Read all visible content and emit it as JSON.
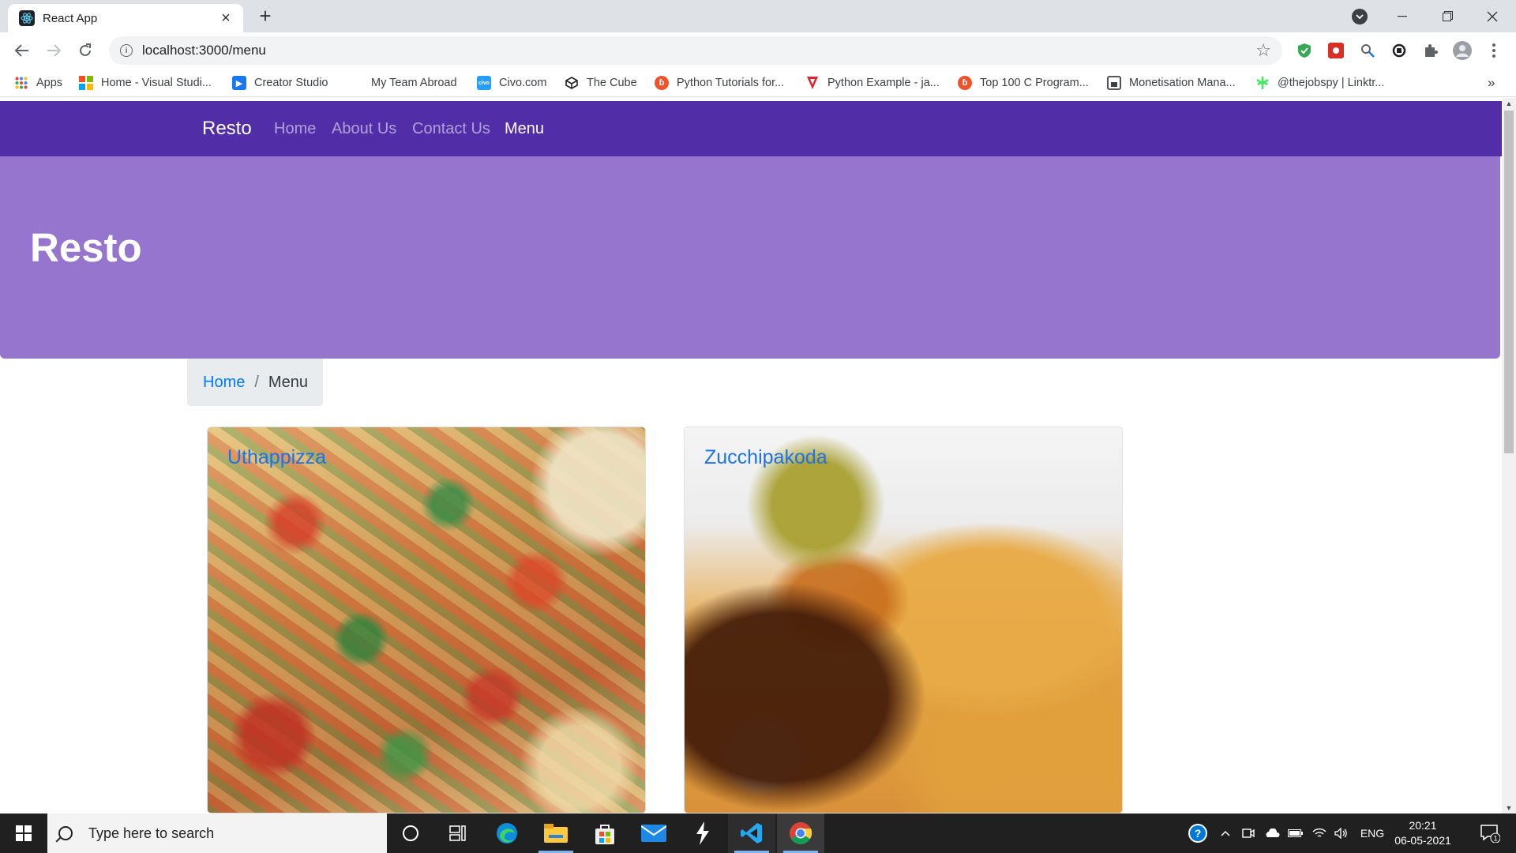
{
  "browser": {
    "tab_title": "React App",
    "url": "localhost:3000/menu",
    "bookmarks": [
      {
        "label": "Apps",
        "icon": "apps-grid-icon"
      },
      {
        "label": "Home - Visual Studi...",
        "icon": "microsoft-icon"
      },
      {
        "label": "Creator Studio",
        "icon": "creator-studio-icon"
      },
      {
        "label": "My Team Abroad",
        "icon": "none"
      },
      {
        "label": "Civo.com",
        "icon": "civo-icon"
      },
      {
        "label": "The Cube",
        "icon": "cube-icon"
      },
      {
        "label": "Python Tutorials for...",
        "icon": "orange-circle-icon"
      },
      {
        "label": "Python Example - ja...",
        "icon": "red-v-icon"
      },
      {
        "label": "Top 100 C Program...",
        "icon": "orange-circle-icon"
      },
      {
        "label": "Monetisation Mana...",
        "icon": "doc-icon"
      },
      {
        "label": "@thejobspy | Linktr...",
        "icon": "linktree-icon"
      }
    ],
    "overflow_glyph": "»"
  },
  "app": {
    "brand": "Resto",
    "nav": [
      {
        "label": "Home",
        "active": false
      },
      {
        "label": "About Us",
        "active": false
      },
      {
        "label": "Contact Us",
        "active": false
      },
      {
        "label": "Menu",
        "active": true
      }
    ],
    "jumbotron_title": "Resto",
    "breadcrumb": {
      "home": "Home",
      "separator": "/",
      "current": "Menu"
    },
    "dishes": [
      {
        "name": "Uthappizza",
        "image": "pizza-photo"
      },
      {
        "name": "Zucchipakoda",
        "image": "pakoda-photo"
      }
    ],
    "colors": {
      "navbar": "#512da8",
      "jumbotron": "#9575cd",
      "link": "#007bff"
    }
  },
  "taskbar": {
    "search_placeholder": "Type here to search",
    "language": "ENG",
    "time": "20:21",
    "date": "06-05-2021",
    "notification_count": "1"
  }
}
